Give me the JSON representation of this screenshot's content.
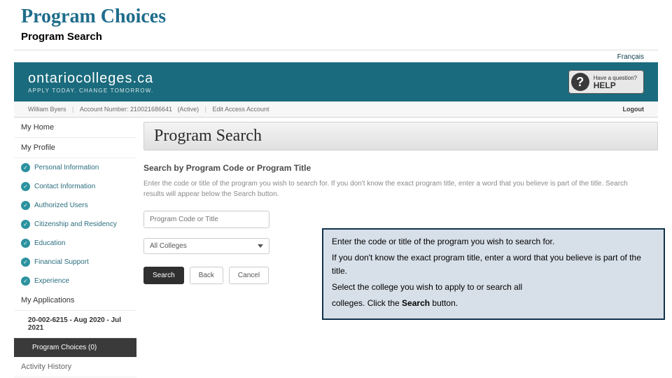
{
  "slide": {
    "title": "Program Choices",
    "subtitle": "Program Search"
  },
  "top_links": {
    "language": "Français"
  },
  "logo": {
    "main": "ontariocolleges.ca",
    "sub": "APPLY TODAY. CHANGE TOMORROW."
  },
  "help": {
    "question": "Have a question?",
    "label": "HELP",
    "icon_text": "?"
  },
  "account": {
    "name": "William Byers",
    "number_label": "Account Number:",
    "number": "210021686641",
    "status": "(Active)",
    "edit": "Edit Access Account",
    "logout": "Logout"
  },
  "sidebar": {
    "my_home": "My Home",
    "my_profile": "My Profile",
    "items": [
      {
        "label": "Personal Information"
      },
      {
        "label": "Contact Information"
      },
      {
        "label": "Authorized Users"
      },
      {
        "label": "Citizenship and Residency"
      },
      {
        "label": "Education"
      },
      {
        "label": "Financial Support"
      },
      {
        "label": "Experience"
      }
    ],
    "my_apps": "My Applications",
    "app_entry": "20-002-6215 - Aug 2020 - Jul 2021",
    "program_choices": "Program Choices (0)",
    "activity": "Activity History"
  },
  "main": {
    "page_title": "Program Search",
    "section_heading": "Search by Program Code or Program Title",
    "helper_text": "Enter the code or title of the program you wish to search for. If you don't know the exact program title, enter a word that you believe is part of the title. Search results will appear below the Search button.",
    "input_placeholder": "Program Code or Title",
    "select_value": "All Colleges",
    "buttons": {
      "search": "Search",
      "back": "Back",
      "cancel": "Cancel"
    }
  },
  "callout": {
    "p1": "Enter the code or title of the program you wish to search for.",
    "p2": "If you don't know the exact program title, enter a word that  you believe is part of the title.",
    "p3": "Select the college you wish to apply to or search all",
    "p4_a": "colleges.  Click the ",
    "p4_bold": "Search",
    "p4_b": " button."
  }
}
